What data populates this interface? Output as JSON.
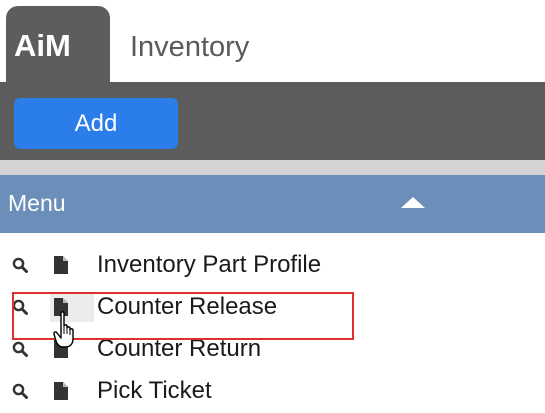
{
  "header": {
    "logo": "AiM",
    "title": "Inventory"
  },
  "toolbar": {
    "add_label": "Add"
  },
  "menu": {
    "title": "Menu",
    "collapse_icon": "caret-up-icon",
    "items": [
      {
        "label": "Inventory Part Profile",
        "search_icon": "search-icon",
        "doc_icon": "document-icon"
      },
      {
        "label": "Counter Release",
        "search_icon": "search-icon",
        "doc_icon": "document-icon"
      },
      {
        "label": "Counter Return",
        "search_icon": "search-icon",
        "doc_icon": "document-icon"
      },
      {
        "label": "Pick Ticket",
        "search_icon": "search-icon",
        "doc_icon": "document-icon"
      }
    ]
  },
  "colors": {
    "toolbar": "#5c5c5c",
    "accent": "#2b7de9",
    "menu_header": "#6b8fb9",
    "highlight": "#e0302b"
  }
}
